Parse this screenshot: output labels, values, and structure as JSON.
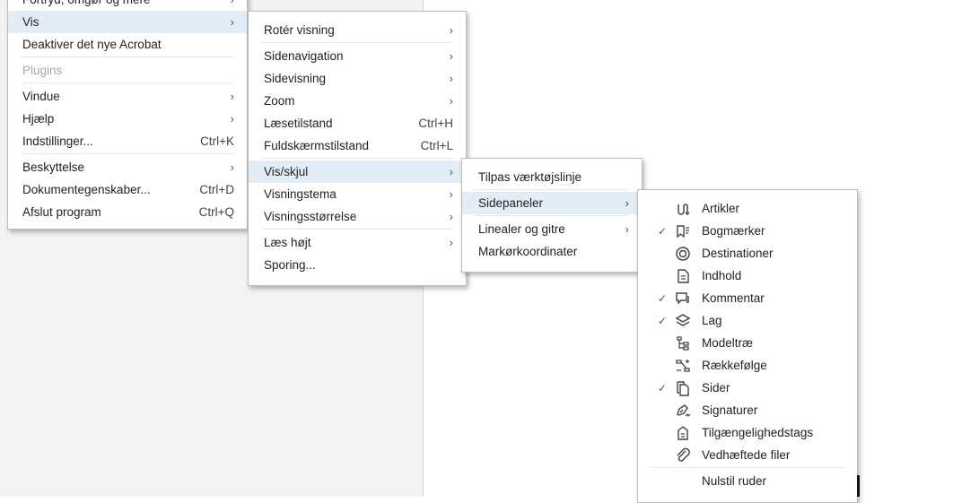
{
  "menus": {
    "main": [
      {
        "label": "Fortryd, omgør og mere",
        "submenu": true
      },
      {
        "label": "Vis",
        "submenu": true,
        "highlighted": true
      },
      {
        "label": "Deaktiver det nye Acrobat"
      },
      {
        "separator": true
      },
      {
        "label": "Plugins",
        "disabled": true
      },
      {
        "separator": true
      },
      {
        "label": "Vindue",
        "submenu": true
      },
      {
        "label": "Hjælp",
        "submenu": true
      },
      {
        "label": "Indstillinger...",
        "shortcut": "Ctrl+K"
      },
      {
        "separator": true
      },
      {
        "label": "Beskyttelse",
        "submenu": true
      },
      {
        "label": "Dokumentegenskaber...",
        "shortcut": "Ctrl+D"
      },
      {
        "label": "Afslut program",
        "shortcut": "Ctrl+Q"
      }
    ],
    "vis": [
      {
        "label": "Rotér visning",
        "submenu": true
      },
      {
        "separator": true
      },
      {
        "label": "Sidenavigation",
        "submenu": true
      },
      {
        "label": "Sidevisning",
        "submenu": true
      },
      {
        "label": "Zoom",
        "submenu": true
      },
      {
        "label": "Læsetilstand",
        "shortcut": "Ctrl+H"
      },
      {
        "label": "Fuldskærmstilstand",
        "shortcut": "Ctrl+L"
      },
      {
        "separator": true
      },
      {
        "label": "Vis/skjul",
        "submenu": true,
        "highlighted": true
      },
      {
        "label": "Visningstema",
        "submenu": true
      },
      {
        "label": "Visningsstørrelse",
        "submenu": true
      },
      {
        "separator": true
      },
      {
        "label": "Læs højt",
        "submenu": true
      },
      {
        "label": "Sporing..."
      }
    ],
    "visskjul": [
      {
        "label": "Tilpas værktøjslinje"
      },
      {
        "separator": true
      },
      {
        "label": "Sidepaneler",
        "submenu": true,
        "highlighted": true
      },
      {
        "separator": true
      },
      {
        "label": "Linealer og gitre",
        "submenu": true
      },
      {
        "label": "Markørkoordinater"
      }
    ],
    "sidepaneler": [
      {
        "label": "Artikler",
        "icon": "articles-icon",
        "checked": false
      },
      {
        "label": "Bogmærker",
        "icon": "bookmark-icon",
        "checked": true
      },
      {
        "label": "Destinationer",
        "icon": "destination-icon",
        "checked": false
      },
      {
        "label": "Indhold",
        "icon": "content-icon",
        "checked": false
      },
      {
        "label": "Kommentar",
        "icon": "comment-icon",
        "checked": true
      },
      {
        "label": "Lag",
        "icon": "layers-icon",
        "checked": true
      },
      {
        "label": "Modeltræ",
        "icon": "model-tree-icon",
        "checked": false
      },
      {
        "label": "Rækkefølge",
        "icon": "order-icon",
        "checked": false
      },
      {
        "label": "Sider",
        "icon": "pages-icon",
        "checked": true
      },
      {
        "label": "Signaturer",
        "icon": "signature-icon",
        "checked": false
      },
      {
        "label": "Tilgængelighedstags",
        "icon": "accessibility-tags-icon",
        "checked": false
      },
      {
        "label": "Vedhæftede filer",
        "icon": "attachment-icon",
        "checked": false
      },
      {
        "separator": true
      },
      {
        "label": "Nulstil ruder"
      }
    ]
  },
  "glyphs": {
    "chevron": "›",
    "check": "✓"
  }
}
